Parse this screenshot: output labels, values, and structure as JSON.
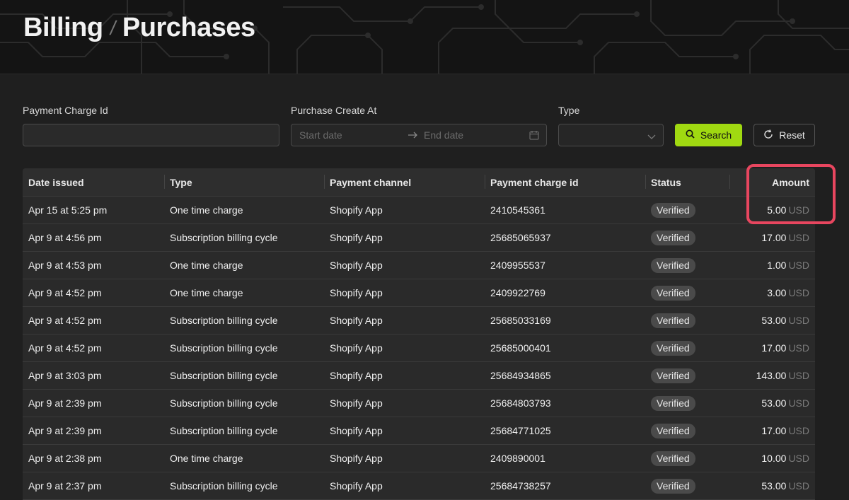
{
  "breadcrumb": {
    "parent": "Billing",
    "separator": "/",
    "current": "Purchases"
  },
  "filters": {
    "payment_charge_id": {
      "label": "Payment Charge Id",
      "value": "",
      "placeholder": ""
    },
    "purchase_create_at": {
      "label": "Purchase Create At",
      "start_placeholder": "Start date",
      "end_placeholder": "End date"
    },
    "type": {
      "label": "Type",
      "value": ""
    },
    "search_label": "Search",
    "reset_label": "Reset"
  },
  "table": {
    "columns": [
      "Date issued",
      "Type",
      "Payment channel",
      "Payment charge id",
      "Status",
      "Amount"
    ],
    "rows": [
      {
        "date": "Apr 15 at 5:25 pm",
        "type": "One time charge",
        "channel": "Shopify App",
        "charge_id": "2410545361",
        "status": "Verified",
        "amount": "5.00",
        "currency": "USD"
      },
      {
        "date": "Apr 9 at 4:56 pm",
        "type": "Subscription billing cycle",
        "channel": "Shopify App",
        "charge_id": "25685065937",
        "status": "Verified",
        "amount": "17.00",
        "currency": "USD"
      },
      {
        "date": "Apr 9 at 4:53 pm",
        "type": "One time charge",
        "channel": "Shopify App",
        "charge_id": "2409955537",
        "status": "Verified",
        "amount": "1.00",
        "currency": "USD"
      },
      {
        "date": "Apr 9 at 4:52 pm",
        "type": "One time charge",
        "channel": "Shopify App",
        "charge_id": "2409922769",
        "status": "Verified",
        "amount": "3.00",
        "currency": "USD"
      },
      {
        "date": "Apr 9 at 4:52 pm",
        "type": "Subscription billing cycle",
        "channel": "Shopify App",
        "charge_id": "25685033169",
        "status": "Verified",
        "amount": "53.00",
        "currency": "USD"
      },
      {
        "date": "Apr 9 at 4:52 pm",
        "type": "Subscription billing cycle",
        "channel": "Shopify App",
        "charge_id": "25685000401",
        "status": "Verified",
        "amount": "17.00",
        "currency": "USD"
      },
      {
        "date": "Apr 9 at 3:03 pm",
        "type": "Subscription billing cycle",
        "channel": "Shopify App",
        "charge_id": "25684934865",
        "status": "Verified",
        "amount": "143.00",
        "currency": "USD"
      },
      {
        "date": "Apr 9 at 2:39 pm",
        "type": "Subscription billing cycle",
        "channel": "Shopify App",
        "charge_id": "25684803793",
        "status": "Verified",
        "amount": "53.00",
        "currency": "USD"
      },
      {
        "date": "Apr 9 at 2:39 pm",
        "type": "Subscription billing cycle",
        "channel": "Shopify App",
        "charge_id": "25684771025",
        "status": "Verified",
        "amount": "17.00",
        "currency": "USD"
      },
      {
        "date": "Apr 9 at 2:38 pm",
        "type": "One time charge",
        "channel": "Shopify App",
        "charge_id": "2409890001",
        "status": "Verified",
        "amount": "10.00",
        "currency": "USD"
      },
      {
        "date": "Apr 9 at 2:37 pm",
        "type": "Subscription billing cycle",
        "channel": "Shopify App",
        "charge_id": "25684738257",
        "status": "Verified",
        "amount": "53.00",
        "currency": "USD"
      }
    ]
  },
  "colors": {
    "accent": "#a0d911",
    "highlight": "#e8465f",
    "background": "#1f1f1f"
  }
}
